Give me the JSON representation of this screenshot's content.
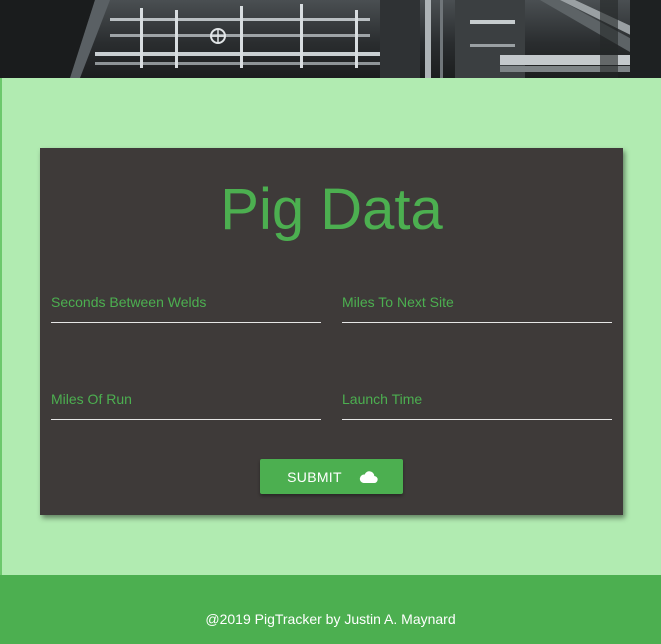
{
  "header": {
    "banner_image": "industrial-pipeline-photo"
  },
  "card": {
    "title": "Pig Data",
    "fields": [
      {
        "label": "Seconds Between Welds",
        "value": ""
      },
      {
        "label": "Miles To Next Site",
        "value": ""
      },
      {
        "label": "Miles Of Run",
        "value": ""
      },
      {
        "label": "Launch Time",
        "value": ""
      }
    ],
    "submit_label": "SUBMIT",
    "submit_icon": "cloud-icon"
  },
  "footer": {
    "text": "@2019 PigTracker by Justin A. Maynard"
  },
  "colors": {
    "page_background": "#b1ebb1",
    "card_background": "#3e3a39",
    "accent": "#4caf50",
    "footer_background": "#4caf50",
    "text_light": "#ffffff"
  }
}
